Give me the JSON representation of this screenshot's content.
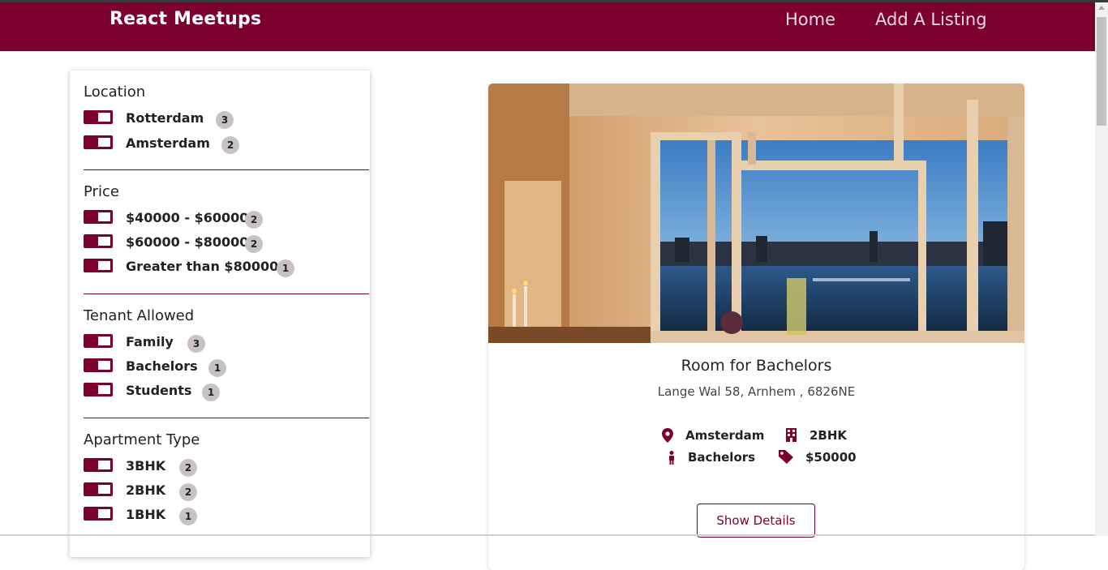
{
  "header": {
    "brand": "React Meetups",
    "nav": {
      "home": "Home",
      "add_listing": "Add A Listing"
    }
  },
  "filters": {
    "location": {
      "title": "Location",
      "options": [
        {
          "label": "Rotterdam",
          "count": "3"
        },
        {
          "label": "Amsterdam",
          "count": "2"
        }
      ]
    },
    "price": {
      "title": "Price",
      "options": [
        {
          "label": "$40000 - $60000",
          "count": "2"
        },
        {
          "label": "$60000 - $80000",
          "count": "2"
        },
        {
          "label": "Greater than $80000",
          "count": "1"
        }
      ]
    },
    "tenant": {
      "title": "Tenant Allowed",
      "options": [
        {
          "label": "Family",
          "count": "3"
        },
        {
          "label": "Bachelors",
          "count": "1"
        },
        {
          "label": "Students",
          "count": "1"
        }
      ]
    },
    "apartment": {
      "title": "Apartment Type",
      "options": [
        {
          "label": "3BHK",
          "count": "2"
        },
        {
          "label": "2BHK",
          "count": "2"
        },
        {
          "label": "1BHK",
          "count": "1"
        }
      ]
    }
  },
  "listing": {
    "title": "Room for Bachelors",
    "address": "Lange Wal 58, Arnhem , 6826NE",
    "location": "Amsterdam",
    "apartment_type": "2BHK",
    "tenant": "Bachelors",
    "price": "$50000",
    "details_button": "Show Details",
    "icons": {
      "location": "map-marker-icon",
      "apartment_type": "building-icon",
      "tenant": "person-icon",
      "price": "price-tag-icon"
    }
  },
  "colors": {
    "brand": "#7b0030",
    "nav_link": "#f0d7e0",
    "badge": "#c9c2c4"
  }
}
